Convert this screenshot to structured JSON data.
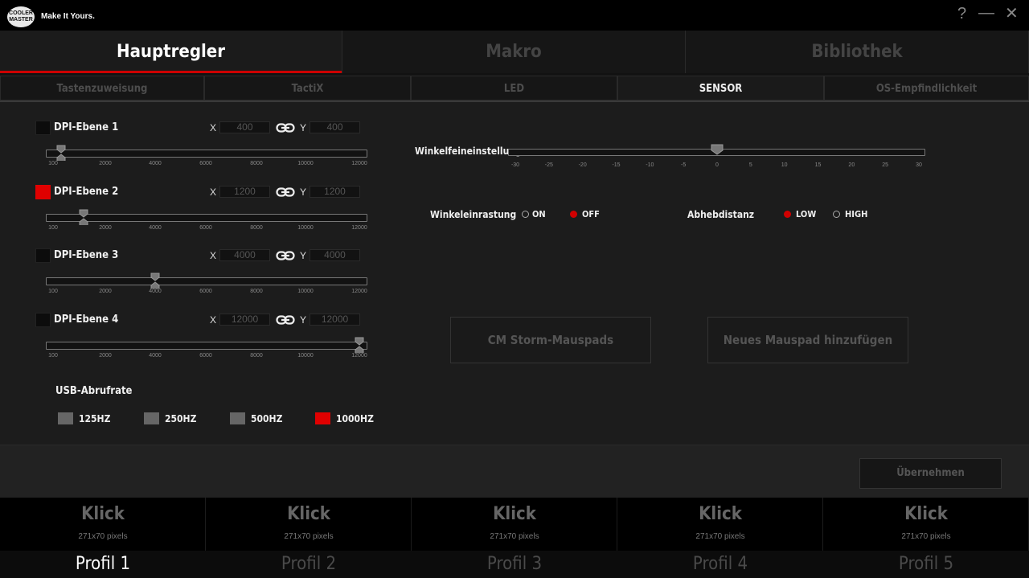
{
  "titlebar": {
    "logo_text": "COOLER MASTER",
    "tagline": "Make It Yours.",
    "help": "?",
    "minimize": "—",
    "close": "✕"
  },
  "main_tabs": [
    {
      "label": "Hauptregler",
      "active": true
    },
    {
      "label": "Makro",
      "active": false
    },
    {
      "label": "Bibliothek",
      "active": false
    }
  ],
  "sub_tabs": [
    {
      "label": "Tastenzuweisung"
    },
    {
      "label": "TactiX"
    },
    {
      "label": "LED"
    },
    {
      "label": "SENSOR",
      "active": true
    },
    {
      "label": "OS-Empfindlichkeit"
    }
  ],
  "dpi": {
    "axis_x": "X",
    "axis_y": "Y",
    "ticks": [
      "100",
      "2000",
      "4000",
      "6000",
      "8000",
      "10000",
      "12000"
    ],
    "levels": [
      {
        "label": "DPI-Ebene 1",
        "checked": false,
        "x": "400",
        "y": "400",
        "value": 400
      },
      {
        "label": "DPI-Ebene 2",
        "checked": true,
        "x": "1200",
        "y": "1200",
        "value": 1200
      },
      {
        "label": "DPI-Ebene 3",
        "checked": false,
        "x": "4000",
        "y": "4000",
        "value": 4000
      },
      {
        "label": "DPI-Ebene 4",
        "checked": false,
        "x": "12000",
        "y": "12000",
        "value": 12000
      }
    ]
  },
  "usb": {
    "title": "USB-Abrufrate",
    "options": [
      {
        "label": "125HZ",
        "selected": false
      },
      {
        "label": "250HZ",
        "selected": false
      },
      {
        "label": "500HZ",
        "selected": false
      },
      {
        "label": "1000HZ",
        "selected": true
      }
    ]
  },
  "angle_tuning": {
    "label": "Winkelfeineinstellung",
    "value": 0,
    "ticks": [
      "-30",
      "-25",
      "-20",
      "-15",
      "-10",
      "-5",
      "0",
      "5",
      "10",
      "15",
      "20",
      "25",
      "30"
    ]
  },
  "angle_snapping": {
    "label": "Winkeleinrastung",
    "on": "ON",
    "off": "OFF",
    "selected": "OFF"
  },
  "lift_off": {
    "label": "Abhebdistanz",
    "low": "LOW",
    "high": "HIGH",
    "selected": "LOW"
  },
  "buttons": {
    "cm_pads": "CM Storm-Mauspads",
    "new_pad": "Neues Mauspad hinzufügen",
    "apply": "Übernehmen"
  },
  "profiles": [
    {
      "image_title": "Klick",
      "image_size": "271x70 pixels",
      "name": "Profil 1",
      "active": true
    },
    {
      "image_title": "Klick",
      "image_size": "271x70 pixels",
      "name": "Profil 2",
      "active": false
    },
    {
      "image_title": "Klick",
      "image_size": "271x70 pixels",
      "name": "Profil 3",
      "active": false
    },
    {
      "image_title": "Klick",
      "image_size": "271x70 pixels",
      "name": "Profil 4",
      "active": false
    },
    {
      "image_title": "Klick",
      "image_size": "271x70 pixels",
      "name": "Profil 5",
      "active": false
    }
  ],
  "colors": {
    "accent": "#e00000",
    "background": "#1c1c1c"
  }
}
